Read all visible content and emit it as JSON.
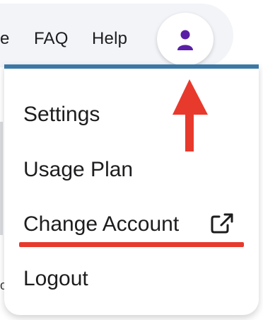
{
  "nav": {
    "partial_link": "e",
    "faq": "FAQ",
    "help": "Help"
  },
  "account_button": {
    "icon": "user-icon",
    "color": "#5b1fa6"
  },
  "menu": {
    "items": [
      {
        "label": "Settings"
      },
      {
        "label": "Usage Plan"
      },
      {
        "label": "Change Account",
        "icon": "external-link-icon"
      },
      {
        "label": "Logout"
      }
    ],
    "accent_color": "#3b78a6"
  },
  "annotation": {
    "arrow_color": "#e8392d",
    "highlight_color": "#e8392d"
  },
  "background_fragment": "o"
}
